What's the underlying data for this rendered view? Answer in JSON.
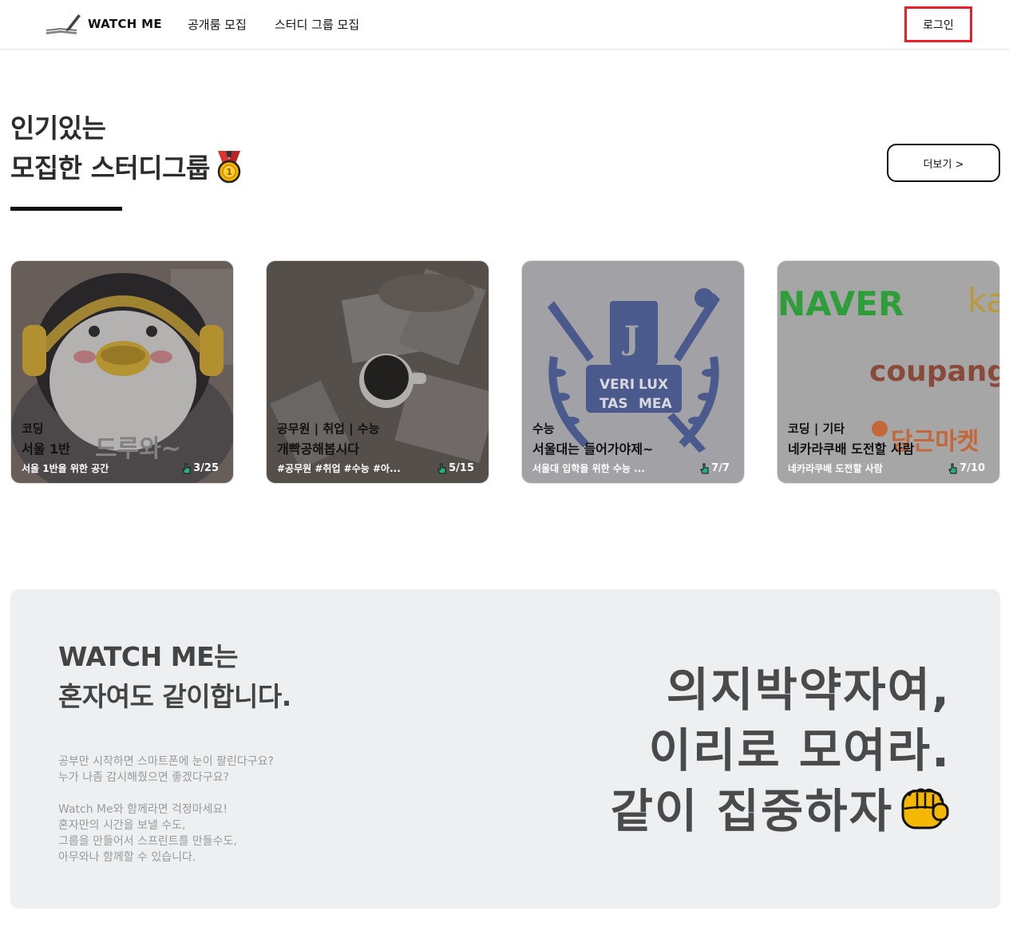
{
  "header": {
    "logo_text": "WATCH ME",
    "nav": [
      "공개룸 모집",
      "스터디 그룹 모집"
    ],
    "login_label": "로그인"
  },
  "popular": {
    "title_line1": "인기있는",
    "title_line2": "모집한 스터디그룹",
    "more_label": "더보기 >"
  },
  "cards": [
    {
      "category": "코딩",
      "name": "서울 1반",
      "description": "서울 1반을 위한 공간",
      "count": "3/25",
      "image_text": "드루와~"
    },
    {
      "category": "공무원 | 취업 | 수능",
      "name": "개빡공해봅시다",
      "description": "#공무원 #취업 #수능 #아...",
      "count": "5/15"
    },
    {
      "category": "수능",
      "name": "서울대는 들어가야제~",
      "description": "서울대 입학을 위한 수능 ...",
      "count": "7/7",
      "image_text_1": "VERI",
      "image_text_2": "LUX",
      "image_text_3": "TAS",
      "image_text_4": "MEA"
    },
    {
      "category": "코딩 | 기타",
      "name": "네카라쿠배 도전할 사람",
      "description": "네카라쿠배 도전할 사람",
      "count": "7/10",
      "image_text_1": "NAVER",
      "image_text_2": "ka",
      "image_text_3": "coupang",
      "image_text_4": "당근마켓"
    }
  ],
  "banner": {
    "heading_line1": "WATCH ME는",
    "heading_line2": "혼자여도 같이합니다.",
    "paragraph": [
      "공부만 시작하면 스마트폰에 눈이 팔린다구요?",
      "누가 나좀 감시해줬으면 좋겠다구요?",
      "",
      "Watch Me와 함께라면 걱정마세요!",
      "혼자만의 시간을 보낼 수도,",
      "그룹을 만들어서 스프린트를 만들수도,",
      "아무와나 함께할 수 있습니다."
    ],
    "slogan": [
      "의지박약자여,",
      "이리로 모여라.",
      "같이 집중하자"
    ]
  },
  "colors": {
    "login_border": "#e8202a",
    "banner_bg": "#eeeff1",
    "naver_green": "#2db400",
    "coupang_brown": "#a1462a",
    "daangn_orange": "#ff7e36"
  },
  "icons": [
    "pen-book-logo-icon",
    "medal-icon",
    "hand-pointer-icon",
    "fist-icon"
  ]
}
